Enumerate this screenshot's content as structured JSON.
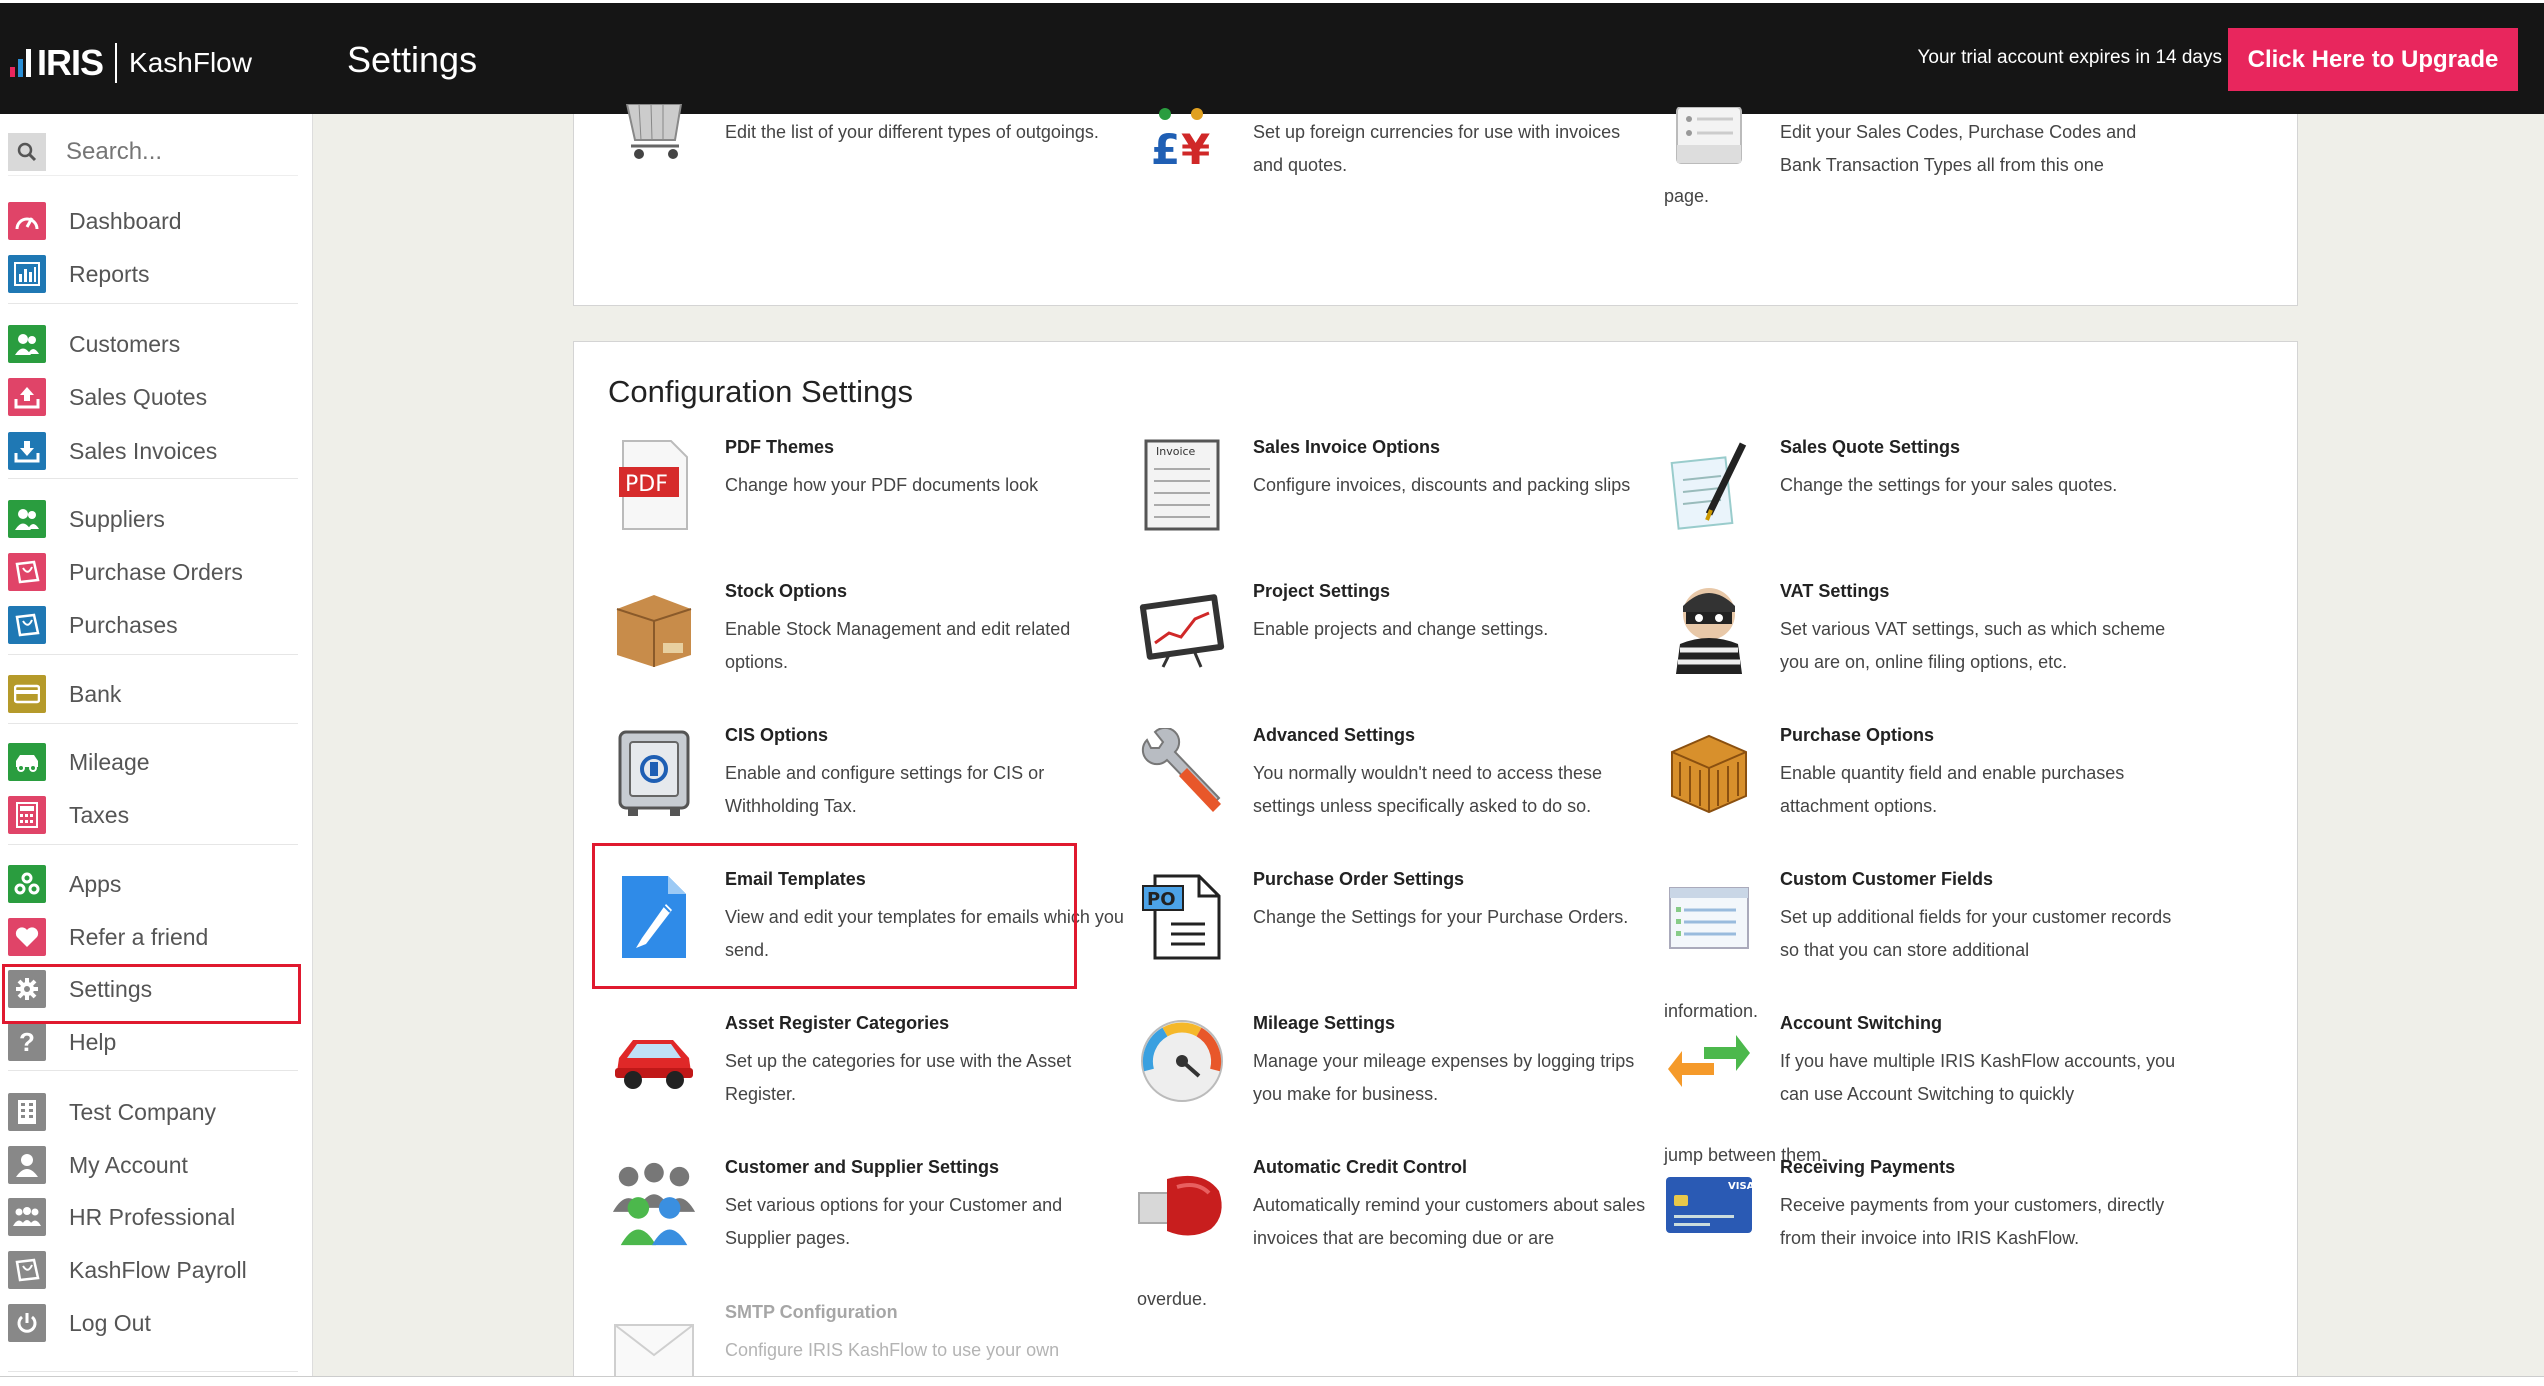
{
  "header": {
    "logo_text": "IRIS",
    "logo_sub": "KashFlow",
    "title": "Settings",
    "trial_text": "Your trial account expires in 14 days",
    "upgrade_label": "Click Here to Upgrade",
    "upgrade_color": "#e8265d"
  },
  "sidebar": {
    "search_placeholder": "Search...",
    "items": [
      {
        "label": "Dashboard",
        "icon": "speedometer-icon",
        "color": "#e04468"
      },
      {
        "label": "Reports",
        "icon": "bar-chart-icon",
        "color": "#1f78b4"
      },
      {
        "label": "Customers",
        "icon": "users-icon",
        "color": "#2a9d3f"
      },
      {
        "label": "Sales Quotes",
        "icon": "upload-tray-icon",
        "color": "#e04468"
      },
      {
        "label": "Sales Invoices",
        "icon": "download-tray-icon",
        "color": "#1f78b4"
      },
      {
        "label": "Suppliers",
        "icon": "users-icon",
        "color": "#2a9d3f"
      },
      {
        "label": "Purchase Orders",
        "icon": "bag-icon",
        "color": "#e04468"
      },
      {
        "label": "Purchases",
        "icon": "bag-icon",
        "color": "#1f78b4"
      },
      {
        "label": "Bank",
        "icon": "card-icon",
        "color": "#b59a2a"
      },
      {
        "label": "Mileage",
        "icon": "car-icon",
        "color": "#2a9d3f"
      },
      {
        "label": "Taxes",
        "icon": "calculator-icon",
        "color": "#e04468"
      },
      {
        "label": "Apps",
        "icon": "apps-icon",
        "color": "#2a9d3f"
      },
      {
        "label": "Refer a friend",
        "icon": "heart-icon",
        "color": "#e04468"
      },
      {
        "label": "Settings",
        "icon": "gear-icon",
        "color": "#888888"
      },
      {
        "label": "Help",
        "icon": "question-icon",
        "color": "#888888"
      },
      {
        "label": "Test Company",
        "icon": "building-icon",
        "color": "#888888"
      },
      {
        "label": "My Account",
        "icon": "user-icon",
        "color": "#888888"
      },
      {
        "label": "HR Professional",
        "icon": "group-icon",
        "color": "#888888"
      },
      {
        "label": "KashFlow Payroll",
        "icon": "bag-icon",
        "color": "#888888"
      },
      {
        "label": "Log Out",
        "icon": "power-icon",
        "color": "#888888"
      }
    ]
  },
  "top_panel": {
    "tiles": [
      {
        "desc": "Edit the list of your different types of outgoings.",
        "icon": "shopping-cart-icon"
      },
      {
        "desc": "Set up foreign currencies for use with invoices and quotes.",
        "icon": "currency-icon"
      },
      {
        "desc": "Edit your Sales Codes, Purchase Codes and Bank Transaction Types all from this one",
        "tail": "page.",
        "icon": "list-icon"
      }
    ]
  },
  "config": {
    "title": "Configuration Settings",
    "tiles": [
      {
        "name": "PDF Themes",
        "desc": "Change how your PDF documents look",
        "icon": "pdf-icon"
      },
      {
        "name": "Sales Invoice Options",
        "desc": "Configure invoices, discounts and packing slips",
        "icon": "invoice-icon"
      },
      {
        "name": "Sales Quote Settings",
        "desc": "Change the settings for your sales quotes.",
        "icon": "pen-paper-icon"
      },
      {
        "name": "Stock Options",
        "desc": "Enable Stock Management and edit related options.",
        "icon": "box-icon"
      },
      {
        "name": "Project Settings",
        "desc": "Enable projects and change settings.",
        "icon": "chart-screen-icon"
      },
      {
        "name": "VAT Settings",
        "desc": "Set various VAT settings, such as which scheme you are on, online filing options, etc.",
        "icon": "burglar-icon"
      },
      {
        "name": "CIS Options",
        "desc": "Enable and configure settings for CIS or Withholding Tax.",
        "icon": "safe-icon"
      },
      {
        "name": "Advanced Settings",
        "desc": "You normally wouldn't need to access these settings unless specifically asked to do so.",
        "icon": "wrench-icon"
      },
      {
        "name": "Purchase Options",
        "desc": "Enable quantity field and enable purchases attachment options.",
        "icon": "crate-icon"
      },
      {
        "name": "Email Templates",
        "desc": "View and edit your templates for emails which you send.",
        "icon": "document-pen-icon"
      },
      {
        "name": "Purchase Order Settings",
        "desc": "Change the Settings for your Purchase Orders.",
        "icon": "po-document-icon"
      },
      {
        "name": "Custom Customer Fields",
        "desc": "Set up additional fields for your customer records so that you can store additional",
        "tail": "information.",
        "icon": "form-icon"
      },
      {
        "name": "Asset Register Categories",
        "desc": "Set up the categories for use with the Asset Register.",
        "icon": "car-icon"
      },
      {
        "name": "Mileage Settings",
        "desc": "Manage your mileage expenses by logging trips you make for business.",
        "icon": "gauge-icon"
      },
      {
        "name": "Account Switching",
        "desc": "If you have multiple IRIS KashFlow accounts, you can use Account Switching to quickly",
        "tail": "jump between them.",
        "icon": "arrows-icon"
      },
      {
        "name": "Customer and Supplier Settings",
        "desc": "Set various options for your Customer and Supplier pages.",
        "icon": "people-icon"
      },
      {
        "name": "Automatic Credit Control",
        "desc": "Automatically remind your customers about sales invoices that are becoming due or are",
        "tail": "overdue.",
        "icon": "boxing-glove-icon"
      },
      {
        "name": "Receiving Payments",
        "desc": "Receive payments from your customers, directly from their invoice into IRIS KashFlow.",
        "icon": "credit-card-icon"
      },
      {
        "name": "SMTP Configuration",
        "desc": "Configure IRIS KashFlow to use your own",
        "icon": "envelope-icon"
      }
    ]
  }
}
